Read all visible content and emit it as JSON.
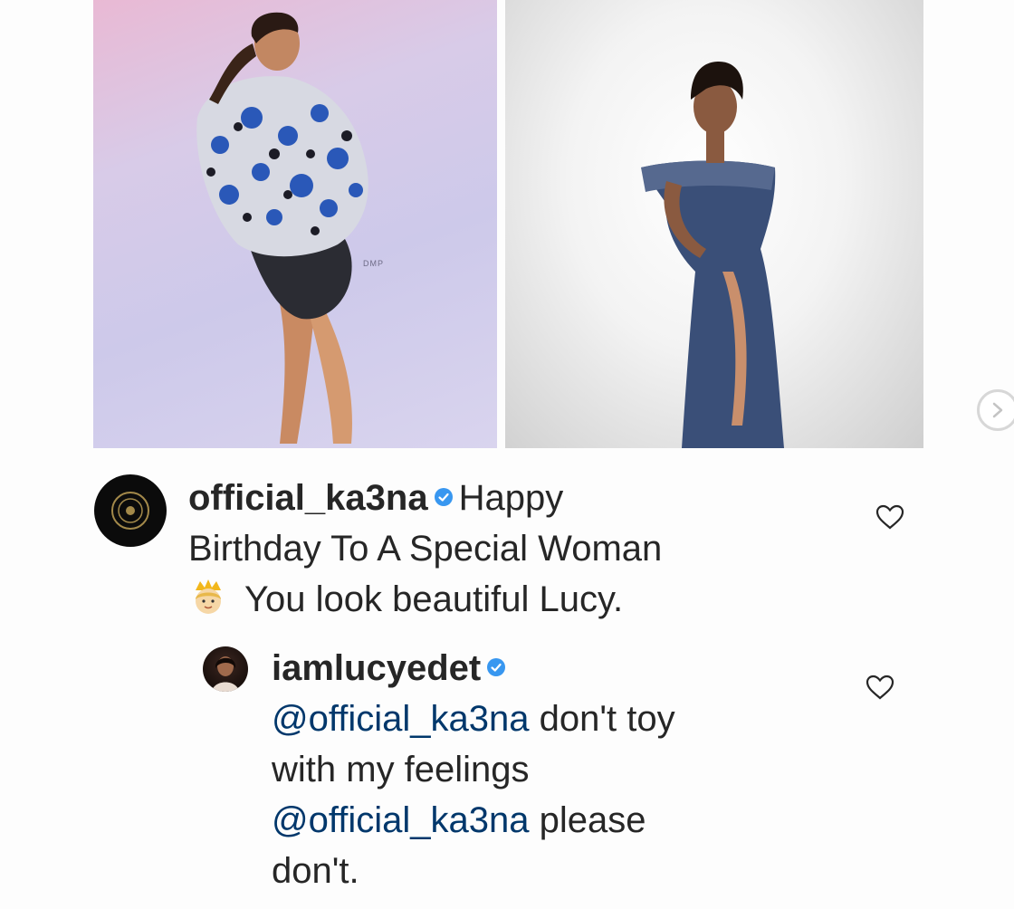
{
  "post": {
    "photo_watermark": "DMP",
    "next_arrow_icon": "chevron-right-icon"
  },
  "comments": [
    {
      "username": "official_ka3na",
      "verified": true,
      "text_line1": "Happy",
      "text_line2": "Birthday To A Special Woman",
      "text_line3": "You look beautiful Lucy.",
      "emoji": "princess-emoji",
      "like_icon": "heart-icon"
    },
    {
      "username": "iamlucyedet",
      "verified": true,
      "mention_1": "@official_ka3na",
      "text_1": "don't toy",
      "text_2": "with my feelings",
      "mention_2": "@official_ka3na",
      "text_3": "please",
      "text_4": "don't.",
      "like_icon": "heart-icon"
    }
  ],
  "colors": {
    "verified_badge": "#3897f0",
    "mention": "#00376b",
    "text": "#262626"
  }
}
